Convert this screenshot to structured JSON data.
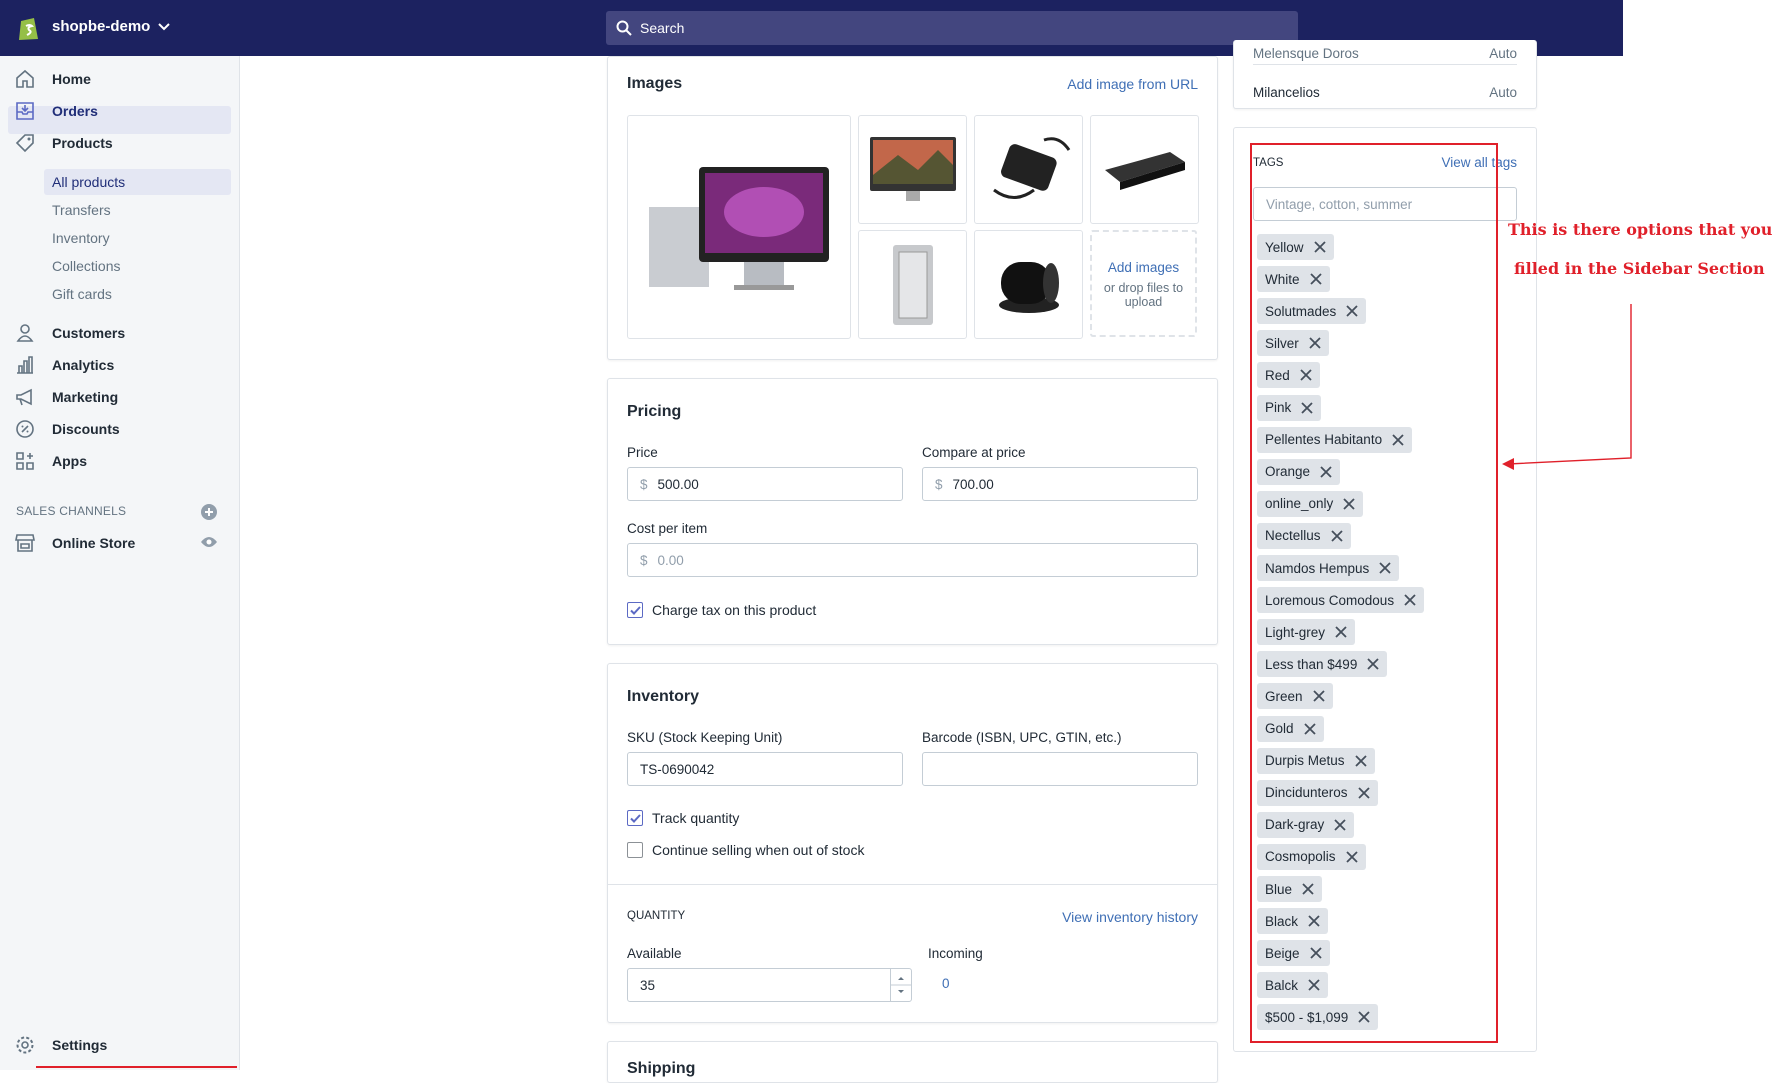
{
  "topbar": {
    "store_name": "shopbe-demo",
    "search_placeholder": "Search"
  },
  "sidebar": {
    "items": [
      {
        "label": "Home",
        "icon": "home-icon"
      },
      {
        "label": "Orders",
        "icon": "orders-icon"
      },
      {
        "label": "Products",
        "icon": "tag-icon"
      },
      {
        "label": "Customers",
        "icon": "person-icon"
      },
      {
        "label": "Analytics",
        "icon": "bar-chart-icon"
      },
      {
        "label": "Marketing",
        "icon": "megaphone-icon"
      },
      {
        "label": "Discounts",
        "icon": "discount-icon"
      },
      {
        "label": "Apps",
        "icon": "apps-icon"
      }
    ],
    "sub_items": [
      "All products",
      "Transfers",
      "Inventory",
      "Collections",
      "Gift cards"
    ],
    "sales_channels_label": "SALES CHANNELS",
    "online_store": "Online Store",
    "settings": "Settings"
  },
  "images": {
    "title": "Images",
    "add_url": "Add image from URL",
    "add_images": "Add images",
    "drop_text": "or drop files to upload"
  },
  "pricing": {
    "title": "Pricing",
    "price_label": "Price",
    "price_currency": "$",
    "price_value": "500.00",
    "compare_label": "Compare at price",
    "compare_currency": "$",
    "compare_value": "700.00",
    "cost_label": "Cost per item",
    "cost_currency": "$",
    "cost_placeholder": "0.00",
    "charge_tax": "Charge tax on this product"
  },
  "inventory": {
    "title": "Inventory",
    "sku_label": "SKU (Stock Keeping Unit)",
    "sku_value": "TS-0690042",
    "barcode_label": "Barcode (ISBN, UPC, GTIN, etc.)",
    "track_quantity": "Track quantity",
    "continue_selling": "Continue selling when out of stock",
    "quantity_label": "QUANTITY",
    "view_history": "View inventory history",
    "available_label": "Available",
    "available_value": "35",
    "incoming_label": "Incoming",
    "incoming_value": "0",
    "shipping_title": "Shipping"
  },
  "right_panel": {
    "partial_row_name": "Melensque Doros",
    "partial_row_value": "Auto",
    "row_name": "Milancelios",
    "row_value": "Auto",
    "tags_title": "TAGS",
    "view_all": "View all tags",
    "tags_placeholder": "Vintage, cotton, summer",
    "tags": [
      "Yellow",
      "White",
      "Solutmades",
      "Silver",
      "Red",
      "Pink",
      "Pellentes Habitanto",
      "Orange",
      "online_only",
      "Nectellus",
      "Namdos Hempus",
      "Loremous Comodous",
      "Light-grey",
      "Less than $499",
      "Green",
      "Gold",
      "Durpis Metus",
      "Dincidunteros",
      "Dark-gray",
      "Cosmopolis",
      "Blue",
      "Black",
      "Beige",
      "Balck",
      "$500 - $1,099"
    ]
  },
  "annotation": {
    "line1": "This is there options that you",
    "line2": "filled in the Sidebar Section"
  },
  "colors": {
    "topbar": "#1c2260",
    "accent": "#5c6ac4",
    "link": "#3f6fb5",
    "annotation": "#e0202a"
  }
}
